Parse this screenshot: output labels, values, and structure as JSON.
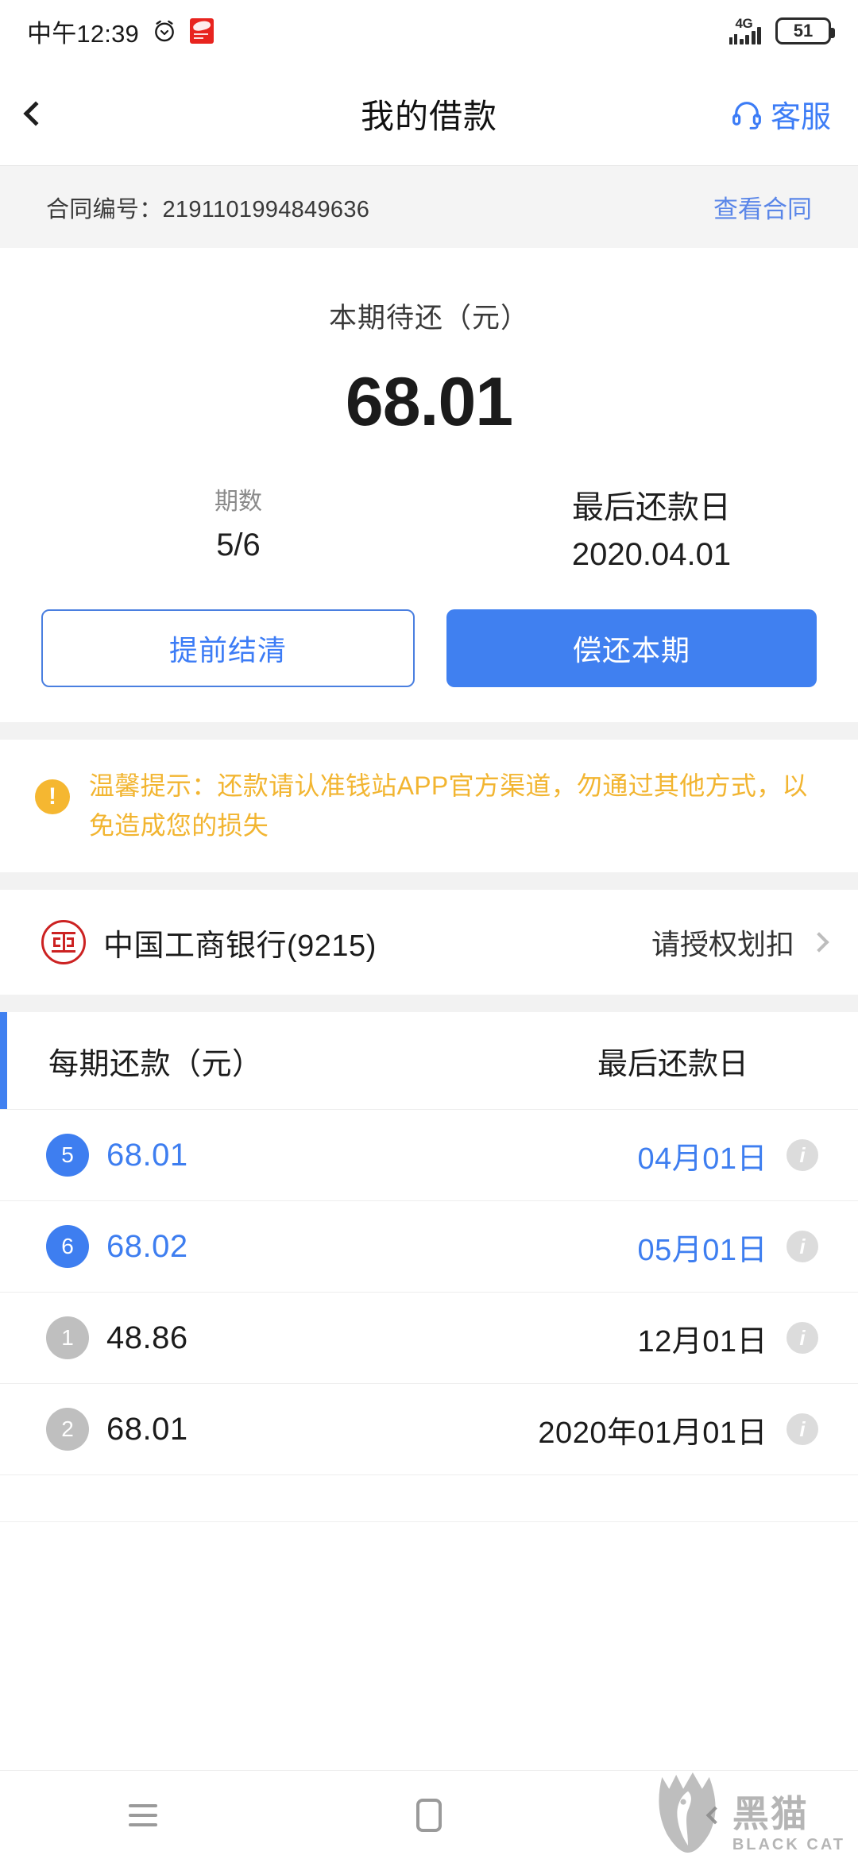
{
  "status_bar": {
    "time": "中午12:39",
    "alarm_icon": "alarm-clock-icon",
    "app_badge_icon": "app-notification-badge",
    "network": "4G",
    "battery_level": "51"
  },
  "app_bar": {
    "back_icon": "chevron-left-icon",
    "title": "我的借款",
    "service_icon": "headset-icon",
    "service_label": "客服"
  },
  "contract": {
    "label": "合同编号：2191101994849636",
    "link": "查看合同"
  },
  "summary": {
    "amount_label": "本期待还（元）",
    "amount": "68.01",
    "period_label": "期数",
    "period_value": "5/6",
    "due_label": "最后还款日",
    "due_value": "2020.04.01",
    "btn_settle": "提前结清",
    "btn_repay": "偿还本期"
  },
  "notice": {
    "icon": "warning-exclamation-icon",
    "text": "温馨提示：还款请认准钱站APP官方渠道，勿通过其他方式，以免造成您的损失"
  },
  "bank": {
    "logo_icon": "icbc-logo-icon",
    "name": "中国工商银行(9215)",
    "action": "请授权划扣",
    "chevron_icon": "chevron-right-icon"
  },
  "schedule": {
    "col_amount": "每期还款（元）",
    "col_date": "最后还款日",
    "rows": [
      {
        "no": "5",
        "amount": "68.01",
        "date": "04月01日",
        "state": "active",
        "info_icon": "info-icon"
      },
      {
        "no": "6",
        "amount": "68.02",
        "date": "05月01日",
        "state": "active",
        "info_icon": "info-icon"
      },
      {
        "no": "1",
        "amount": "48.86",
        "date": "12月01日",
        "state": "done",
        "info_icon": "info-icon"
      },
      {
        "no": "2",
        "amount": "68.01",
        "date": "2020年01月01日",
        "state": "done",
        "info_icon": "info-icon"
      }
    ]
  },
  "nav_bar": {
    "recents_icon": "menu-recents-icon",
    "home_icon": "home-square-icon",
    "back_icon": "nav-back-icon"
  },
  "watermark": {
    "cat_icon": "black-cat-logo-icon",
    "cn": "黑猫",
    "en": "BLACK CAT"
  },
  "colors": {
    "accent_blue": "#4080f0",
    "link_blue": "#3c7cf6",
    "warning_yellow": "#f2b531",
    "bank_red": "#cc2222",
    "muted_gray": "#bfbfbf"
  }
}
